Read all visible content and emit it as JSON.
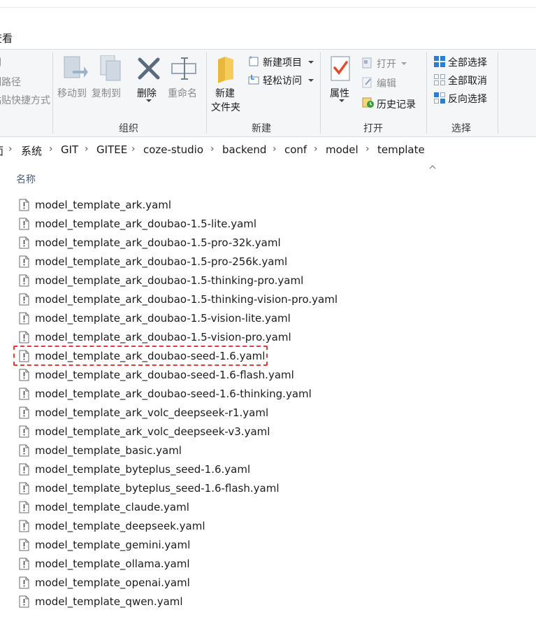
{
  "tabs": {
    "view": "查看"
  },
  "ribbon": {
    "clipboard_partial": {
      "item1": "IJ",
      "item2": "制路径",
      "item3": "粘贴快捷方式"
    },
    "organize": {
      "label": "组织",
      "move_to": "移动到",
      "copy_to": "复制到",
      "delete": "删除",
      "rename": "重命名"
    },
    "new": {
      "label": "新建",
      "new_item": "新建项目",
      "easy_access": "轻松访问",
      "new_folder_line1": "新建",
      "new_folder_line2": "文件夹"
    },
    "open": {
      "label": "打开",
      "properties": "属性",
      "open": "打开",
      "edit": "编辑",
      "history": "历史记录"
    },
    "select": {
      "label": "选择",
      "select_all": "全部选择",
      "select_none": "全部取消",
      "invert": "反向选择"
    }
  },
  "breadcrumb": [
    "系统",
    "GIT",
    "GITEE",
    "coze-studio",
    "backend",
    "conf",
    "model",
    "template"
  ],
  "breadcrumb_partial_first": "面",
  "columns": {
    "name": "名称"
  },
  "files": [
    "model_template_ark.yaml",
    "model_template_ark_doubao-1.5-lite.yaml",
    "model_template_ark_doubao-1.5-pro-32k.yaml",
    "model_template_ark_doubao-1.5-pro-256k.yaml",
    "model_template_ark_doubao-1.5-thinking-pro.yaml",
    "model_template_ark_doubao-1.5-thinking-vision-pro.yaml",
    "model_template_ark_doubao-1.5-vision-lite.yaml",
    "model_template_ark_doubao-1.5-vision-pro.yaml",
    "model_template_ark_doubao-seed-1.6.yaml",
    "model_template_ark_doubao-seed-1.6-flash.yaml",
    "model_template_ark_doubao-seed-1.6-thinking.yaml",
    "model_template_ark_volc_deepseek-r1.yaml",
    "model_template_ark_volc_deepseek-v3.yaml",
    "model_template_basic.yaml",
    "model_template_byteplus_seed-1.6.yaml",
    "model_template_byteplus_seed-1.6-flash.yaml",
    "model_template_claude.yaml",
    "model_template_deepseek.yaml",
    "model_template_gemini.yaml",
    "model_template_ollama.yaml",
    "model_template_openai.yaml",
    "model_template_qwen.yaml"
  ],
  "highlighted_file": "model_template_ark_doubao-seed-1.6.yaml",
  "colors": {
    "highlight_border": "#e23b3b",
    "ribbon_bg": "#f5f6f7",
    "header_text": "#4c607a",
    "accent_blue": "#2a7fd4"
  }
}
